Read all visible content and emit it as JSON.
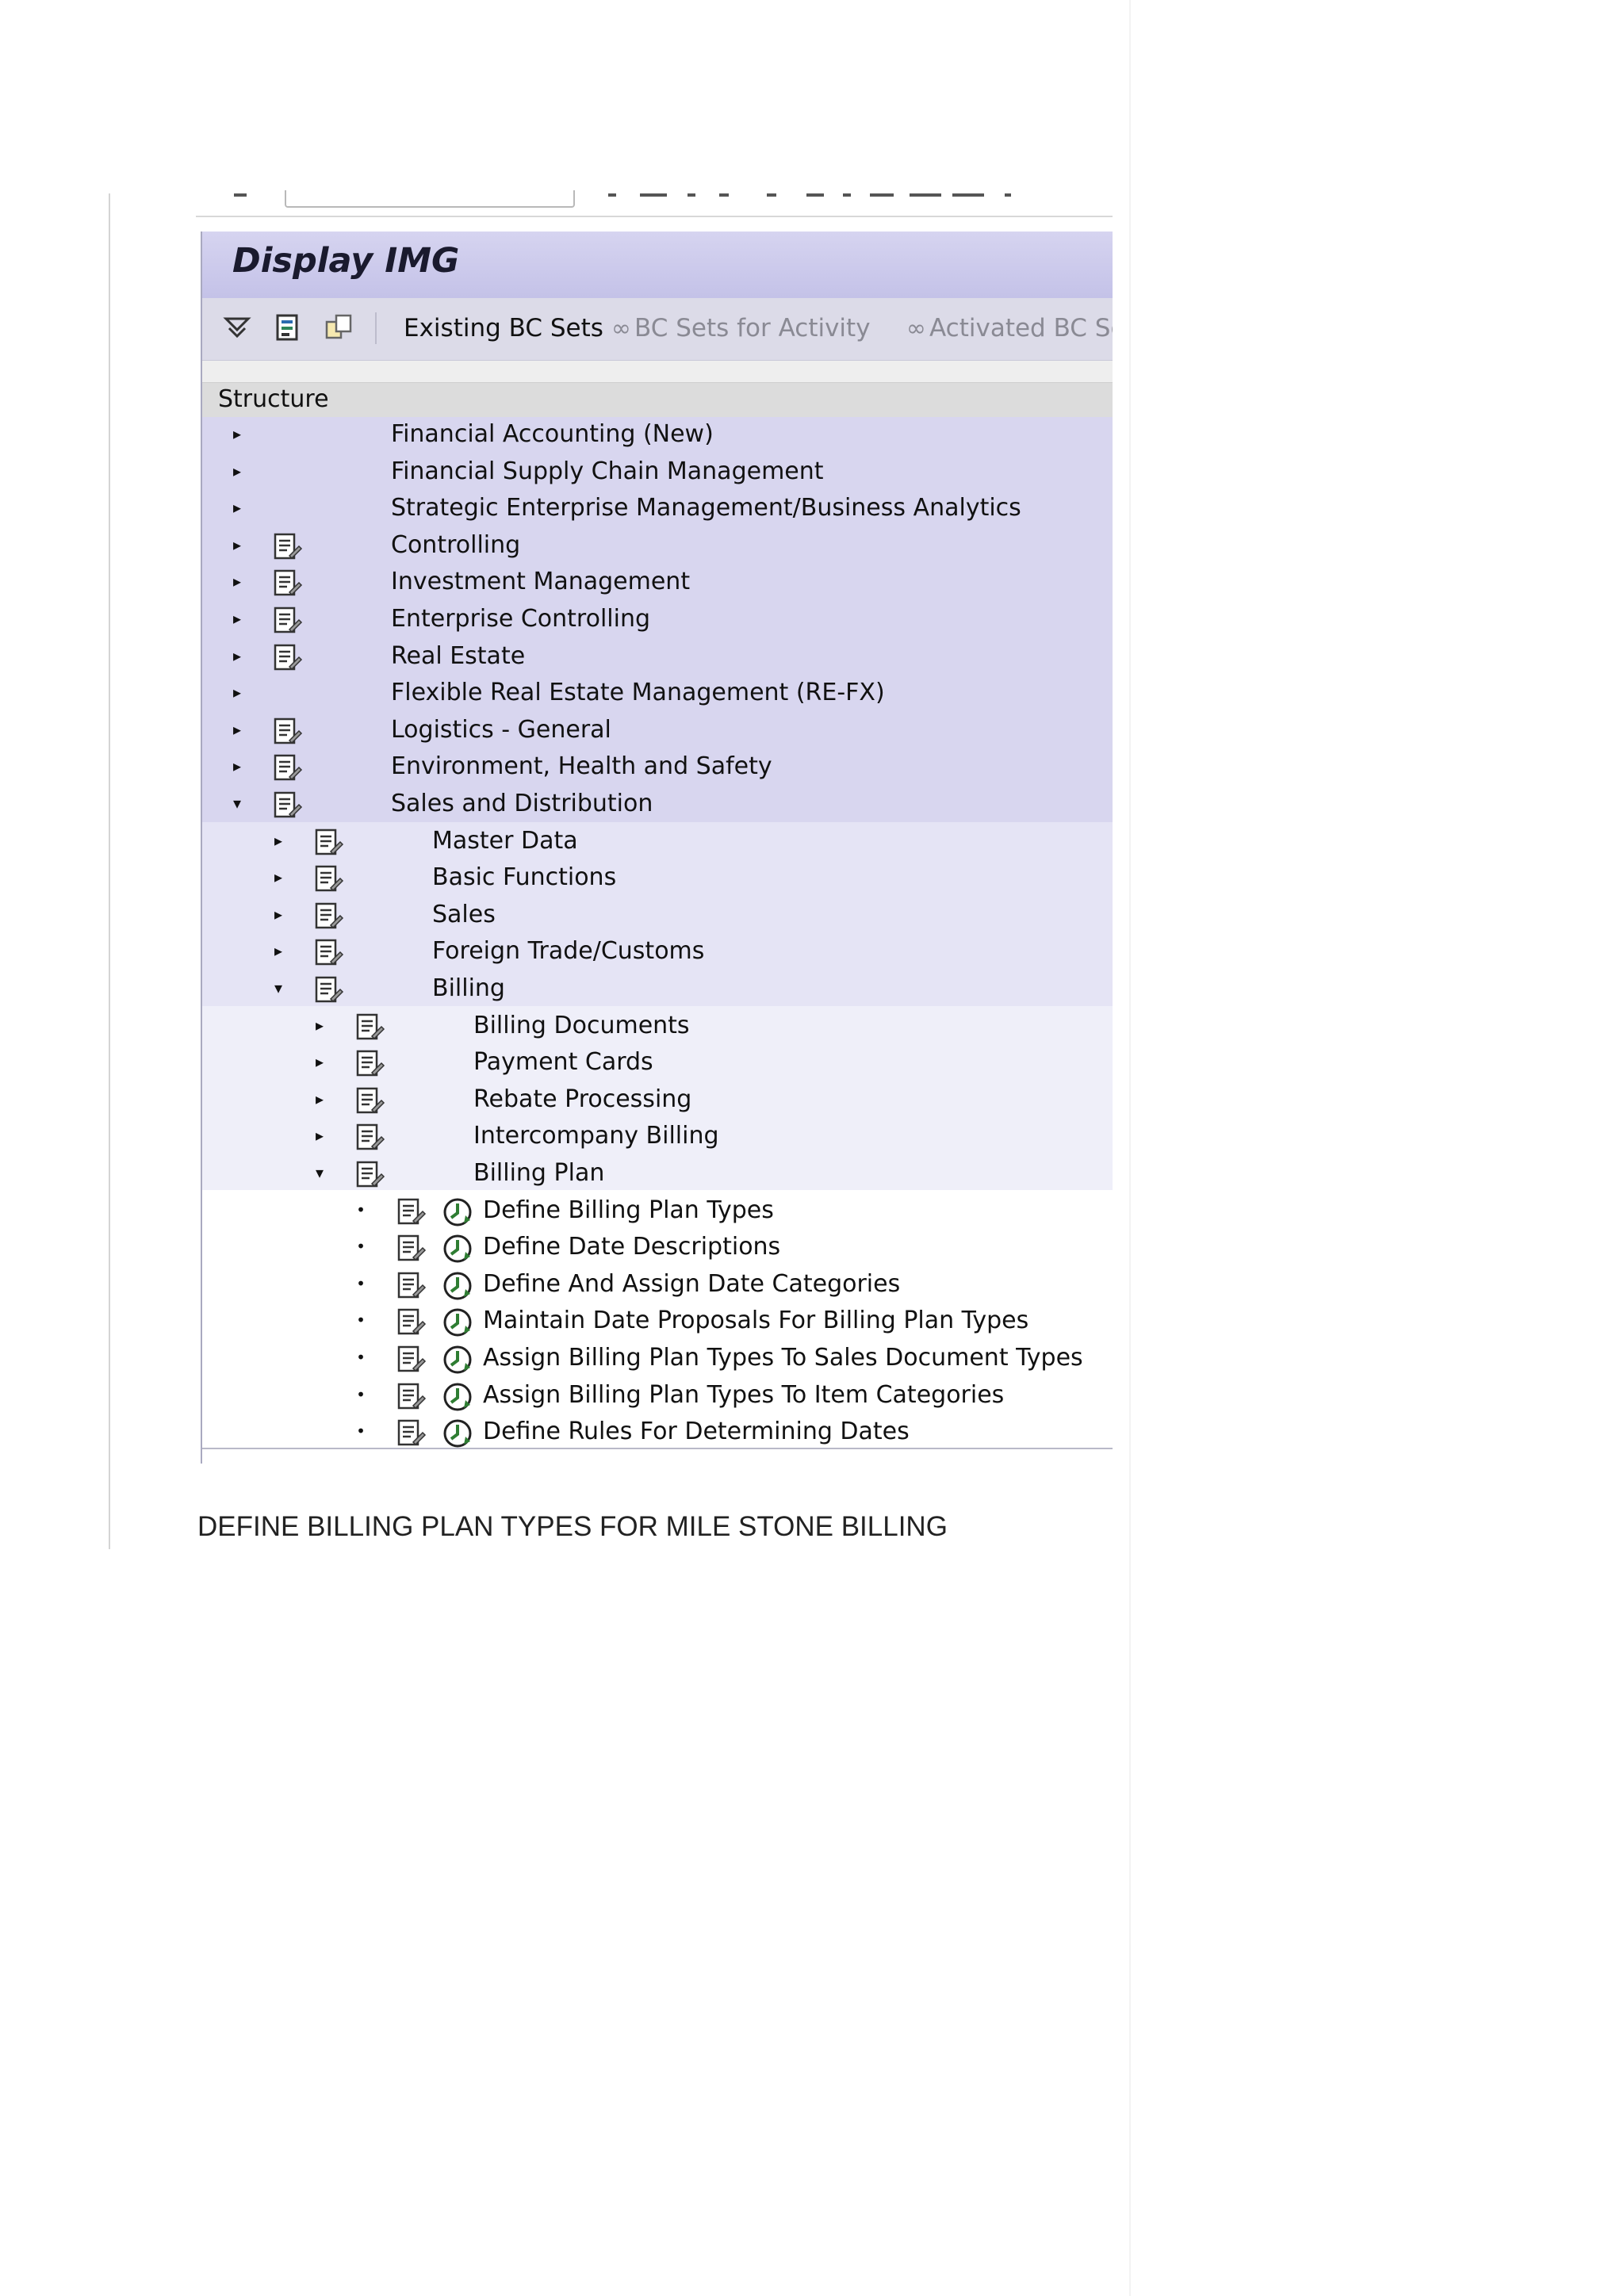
{
  "screen": {
    "title": "Display IMG",
    "toolbar": {
      "icons": [
        "find-icon",
        "docs-icon",
        "copy-icon"
      ],
      "existing_bc_sets": "Existing BC Sets",
      "bc_sets_for_activity": "BC Sets for Activity",
      "activated_bc_sets": "Activated BC Se"
    },
    "structure_header": "Structure",
    "tree": {
      "top_level": [
        {
          "label": "Financial Accounting (New)",
          "has_doc": false
        },
        {
          "label": "Financial Supply Chain Management",
          "has_doc": false
        },
        {
          "label": "Strategic Enterprise Management/Business Analytics",
          "has_doc": false
        },
        {
          "label": "Controlling",
          "has_doc": true
        },
        {
          "label": "Investment Management",
          "has_doc": true
        },
        {
          "label": "Enterprise Controlling",
          "has_doc": true
        },
        {
          "label": "Real Estate",
          "has_doc": true
        },
        {
          "label": "Flexible Real Estate Management (RE-FX)",
          "has_doc": false
        },
        {
          "label": "Logistics - General",
          "has_doc": true
        },
        {
          "label": "Environment, Health and Safety",
          "has_doc": true
        },
        {
          "label": "Sales and Distribution",
          "has_doc": true,
          "expanded": true
        }
      ],
      "sd_children": [
        {
          "label": "Master Data"
        },
        {
          "label": "Basic Functions"
        },
        {
          "label": "Sales"
        },
        {
          "label": "Foreign Trade/Customs"
        },
        {
          "label": "Billing",
          "expanded": true
        }
      ],
      "billing_children": [
        {
          "label": "Billing Documents"
        },
        {
          "label": "Payment Cards"
        },
        {
          "label": "Rebate Processing"
        },
        {
          "label": "Intercompany Billing"
        },
        {
          "label": "Billing Plan",
          "expanded": true
        }
      ],
      "billing_plan_activities": [
        {
          "label": "Define Billing Plan Types"
        },
        {
          "label": "Define Date Descriptions"
        },
        {
          "label": "Define And Assign Date Categories"
        },
        {
          "label": "Maintain Date Proposals For Billing Plan Types"
        },
        {
          "label": "Assign Billing Plan Types To Sales Document Types"
        },
        {
          "label": "Assign Billing Plan Types To Item Categories"
        },
        {
          "label": "Define Rules For Determining Dates"
        }
      ]
    },
    "colors": {
      "title_bar": "#c4c2e8",
      "level1_bg": "#d8d6ef",
      "level2_bg": "#e5e4f5",
      "level3_bg": "#efeff9",
      "activity_clock": "#2e7d32"
    }
  },
  "caption": "DEFINE BILLING PLAN TYPES FOR MILE STONE BILLING"
}
